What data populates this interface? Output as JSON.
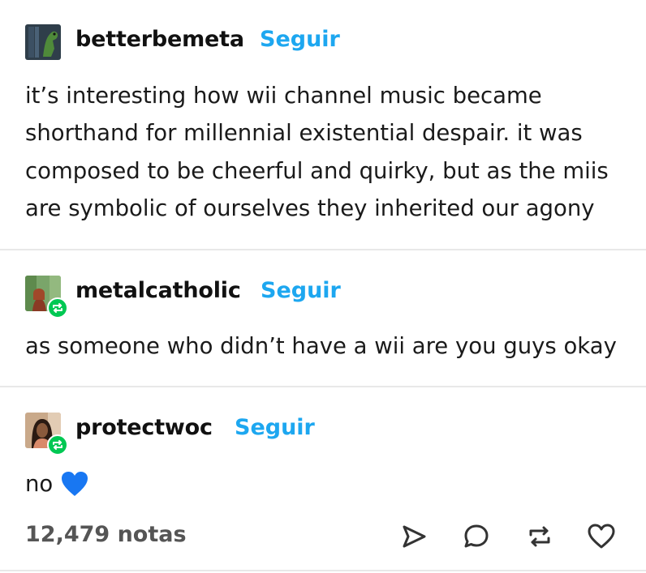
{
  "posts": [
    {
      "username": "betterbemeta",
      "follow_label": "Seguir",
      "lines": [
        "it’s interesting how wii channel music became",
        "shorthand for millennial existential despair. it was",
        "composed to be cheerful and quirky, but as the miis",
        "are symbolic of ourselves they inherited our agony"
      ]
    },
    {
      "username": "metalcatholic",
      "follow_label": "Seguir",
      "lines": [
        "as someone who didn’t have a wii are you guys okay"
      ]
    },
    {
      "username": "protectwoc",
      "follow_label": "Seguir",
      "text": "no",
      "emoji": "💙"
    }
  ],
  "footer": {
    "notes": "12,479 notas",
    "actions": [
      "share-icon",
      "reply-icon",
      "reblog-icon",
      "like-icon"
    ]
  },
  "colors": {
    "follow": "#1da7f0",
    "reblog_badge": "#00c853",
    "heart": "#1877f2"
  }
}
